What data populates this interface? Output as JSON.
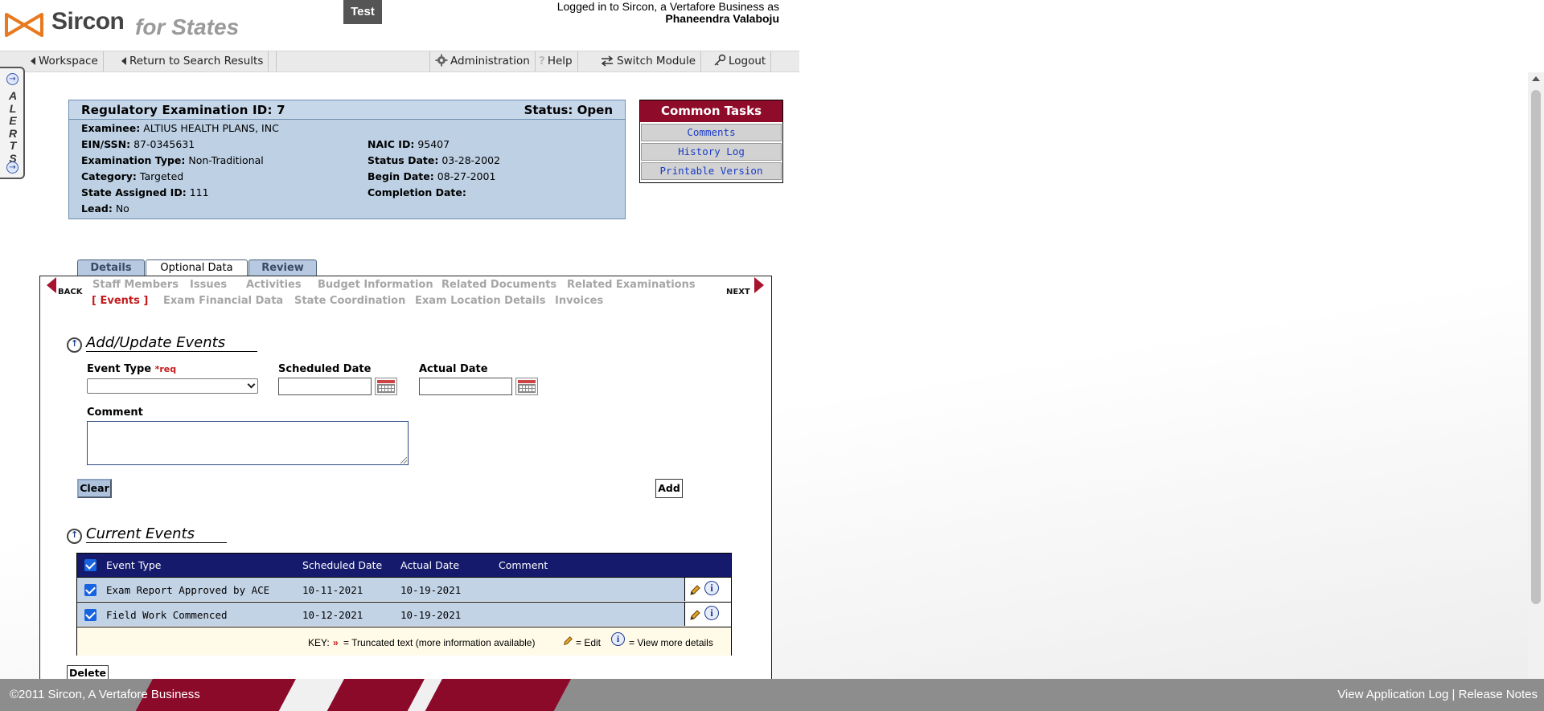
{
  "header": {
    "logo_name": "Sircon",
    "logo_sub": "for States",
    "environment_badge": "Test",
    "login_text": "Logged in to Sircon, a Vertafore Business as",
    "user_name": "Phaneendra Valaboju"
  },
  "navbar": {
    "workspace": "Workspace",
    "return_to_search": "Return to Search Results",
    "administration": "Administration",
    "help": "Help",
    "switch_module": "Switch Module",
    "logout": "Logout"
  },
  "alerts_tab": {
    "label": "ALERTS",
    "letters": [
      "A",
      "L",
      "E",
      "R",
      "T",
      "S"
    ]
  },
  "exam": {
    "title": "Regulatory Examination ID: 7",
    "status": "Status: Open",
    "fields": [
      {
        "label": "Examinee:",
        "value": "ALTIUS HEALTH PLANS, INC"
      },
      {
        "label": "EIN/SSN:",
        "value": "87-0345631"
      },
      {
        "label": "NAIC ID:",
        "value": "95407"
      },
      {
        "label": "Examination Type:",
        "value": "Non-Traditional"
      },
      {
        "label": "Status Date:",
        "value": "03-28-2002"
      },
      {
        "label": "Category:",
        "value": "Targeted"
      },
      {
        "label": "Begin Date:",
        "value": "08-27-2001"
      },
      {
        "label": "State Assigned ID:",
        "value": "111"
      },
      {
        "label": "Completion Date:",
        "value": ""
      },
      {
        "label": "Lead:",
        "value": "No"
      }
    ]
  },
  "common_tasks": {
    "title": "Common Tasks",
    "links": [
      "Comments",
      "History Log",
      "Printable Version"
    ]
  },
  "tabs": [
    {
      "label": "Details",
      "active": false
    },
    {
      "label": "Optional Data",
      "active": true
    },
    {
      "label": "Review",
      "active": false
    }
  ],
  "pager": {
    "back": "BACK",
    "next": "NEXT"
  },
  "sub_nav": {
    "row1": [
      "Staff Members",
      "Issues",
      "Activities",
      "Budget Information",
      "Related Documents",
      "Related Examinations"
    ],
    "row2": [
      "[ Events ]",
      "Exam Financial Data",
      "State Coordination",
      "Exam Location Details",
      "Invoices"
    ],
    "current": "[ Events ]"
  },
  "add_update": {
    "section_title": "Add/Update Events",
    "event_type_label": "Event Type",
    "required_marker": "*req",
    "event_type_value": "",
    "scheduled_date_label": "Scheduled Date",
    "scheduled_date_value": "",
    "actual_date_label": "Actual Date",
    "actual_date_value": "",
    "comment_label": "Comment",
    "comment_value": "",
    "clear_button": "Clear",
    "add_button": "Add"
  },
  "current_events": {
    "section_title": "Current Events",
    "columns": [
      "Event Type",
      "Scheduled Date",
      "Actual Date",
      "Comment"
    ],
    "rows": [
      {
        "event_type": "Exam Report Approved by ACE",
        "scheduled_date": "10-11-2021",
        "actual_date": "10-19-2021",
        "comment": "",
        "checked": true
      },
      {
        "event_type": "Field Work Commenced",
        "scheduled_date": "10-12-2021",
        "actual_date": "10-19-2021",
        "comment": "",
        "checked": true
      }
    ],
    "key": {
      "prefix": "KEY:",
      "truncated_symbol": "»",
      "truncated_text": "= Truncated text (more information available)",
      "edit_text": "= Edit",
      "details_text": "= View more details"
    },
    "delete_button": "Delete"
  },
  "footer": {
    "copyright": "©2011 Sircon, A Vertafore Business",
    "view_log": "View Application Log",
    "separator": "|",
    "release_notes": "Release Notes"
  },
  "colors": {
    "brand_red": "#8f0b2a",
    "info_blue": "#bdd0e4",
    "table_header": "#151a6d",
    "link_blue": "#1a3cc4"
  }
}
